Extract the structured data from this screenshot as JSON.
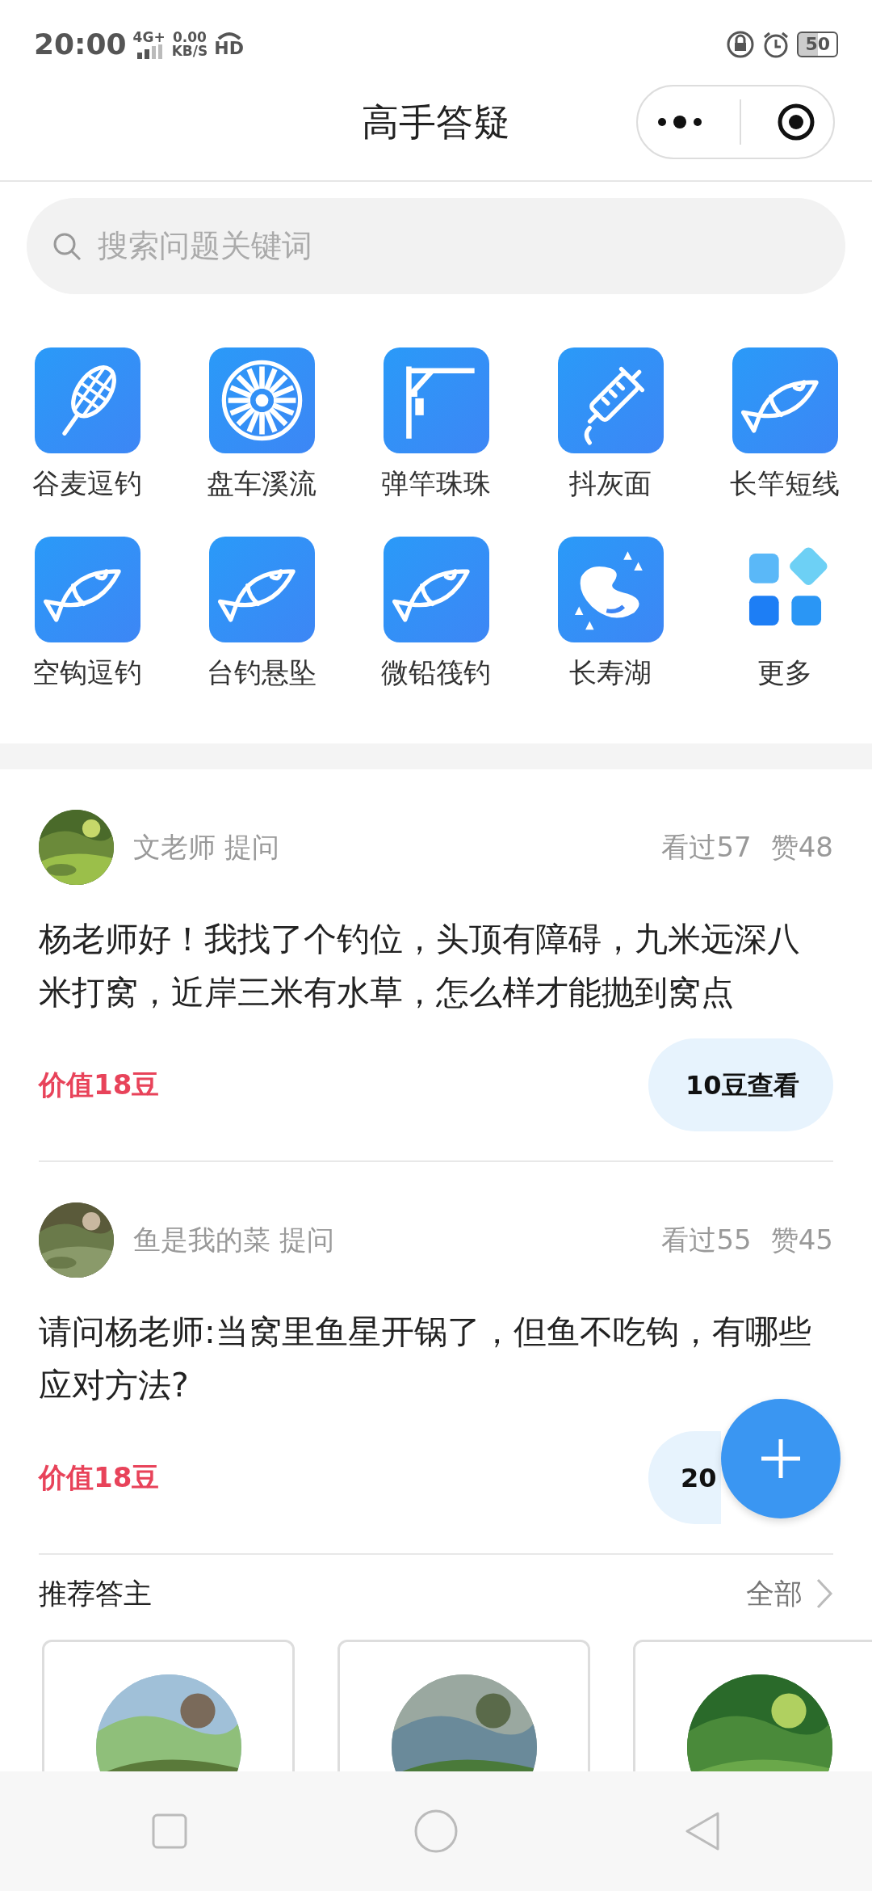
{
  "status_bar": {
    "time": "20:00",
    "network": "4G+",
    "speed": "0.00",
    "speed_unit": "KB/S",
    "hd": "HD",
    "battery": "50"
  },
  "title_bar": {
    "title": "高手答疑"
  },
  "search": {
    "placeholder": "搜索问题关键词"
  },
  "categories": [
    {
      "label": "谷麦逗钓",
      "kind": "net"
    },
    {
      "label": "盘车溪流",
      "kind": "wheel"
    },
    {
      "label": "弹竿珠珠",
      "kind": "rod"
    },
    {
      "label": "抖灰面",
      "kind": "syringe"
    },
    {
      "label": "长竿短线",
      "kind": "fish"
    },
    {
      "label": "空钩逗钓",
      "kind": "fish"
    },
    {
      "label": "台钓悬坠",
      "kind": "fish"
    },
    {
      "label": "微铅筏钓",
      "kind": "fish"
    },
    {
      "label": "长寿湖",
      "kind": "lake"
    },
    {
      "label": "更多",
      "kind": "more"
    }
  ],
  "questions": [
    {
      "asker": "文老师 提问",
      "views": "看过57",
      "likes": "赞48",
      "text": "杨老师好！我找了个钓位，头顶有障碍，九米远深八米打窝，近岸三米有水草，怎么样才能抛到窝点",
      "price": "价值18豆",
      "button": "10豆查看"
    },
    {
      "asker": "鱼是我的菜 提问",
      "views": "看过55",
      "likes": "赞45",
      "text": "请问杨老师:当窝里鱼星开锅了，但鱼不吃钩，有哪些应对方法?",
      "price": "价值18豆",
      "button": "20"
    }
  ],
  "recommended": {
    "title": "推荐答主",
    "more": "全部"
  }
}
